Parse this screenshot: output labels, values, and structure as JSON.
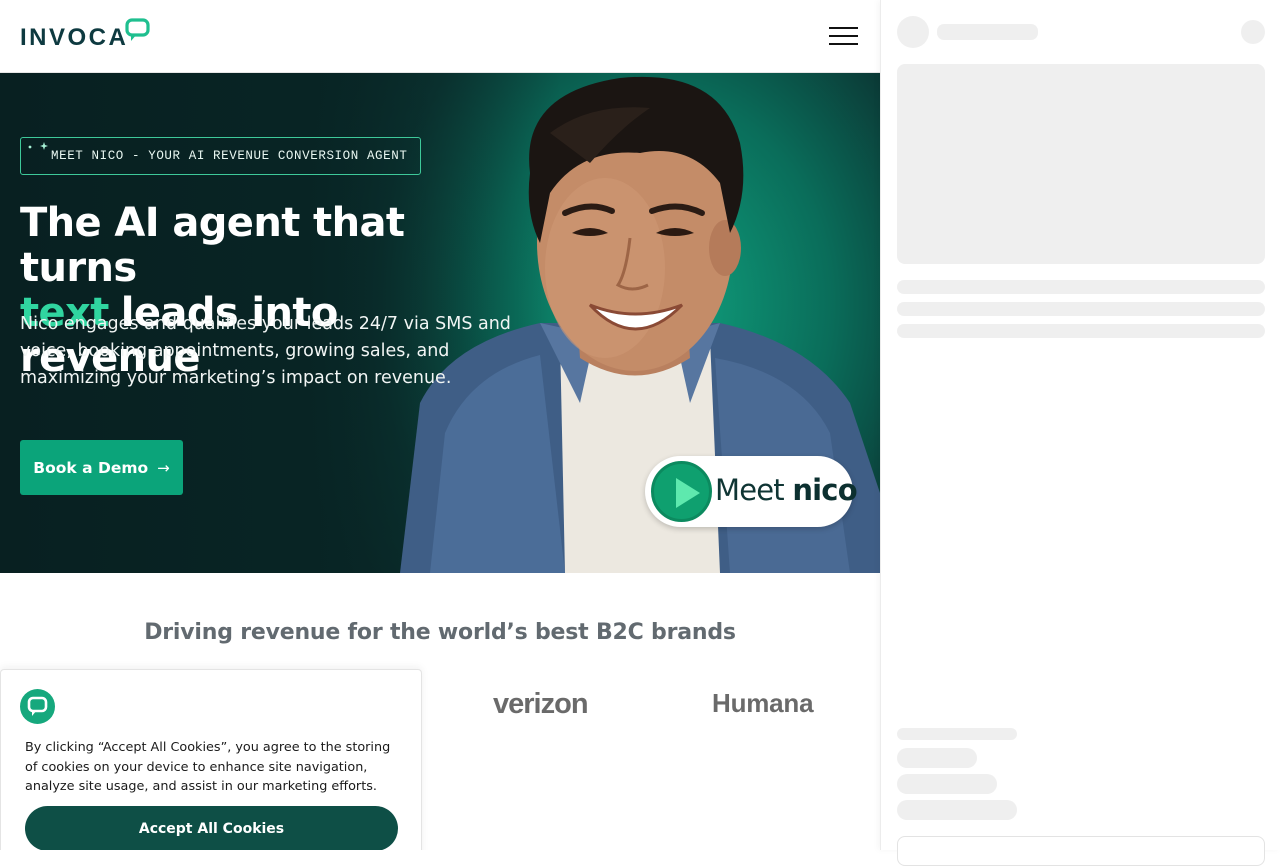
{
  "header": {
    "logo_text": "INVOCA",
    "menu_icon": "hamburger-menu-icon"
  },
  "hero": {
    "badge": "MEET NICO - YOUR AI REVENUE CONVERSION AGENT",
    "headline_line1": "The AI agent that turns",
    "headline_rotating_word": "text",
    "headline_line2": "leads into revenue",
    "subcopy": "Nico engages and qualifies your leads 24/7 via SMS and voice, booking appointments, growing sales, and maximizing your marketing’s impact on revenue.",
    "cta_label": "Book a Demo",
    "cta_icon": "arrow-right-icon",
    "video_pill": {
      "meet": "Meet",
      "name": "nico",
      "icon": "play-icon"
    },
    "colors": {
      "accent": "#0ba47a",
      "rotating_word": "#30d5a0",
      "bg_dark": "#0b2a2a"
    }
  },
  "brands": {
    "title": "Driving revenue for the world’s best B2C brands",
    "logos": [
      "verizon",
      "Humana"
    ]
  },
  "cookie_banner": {
    "text": "By clicking “Accept All Cookies”, you agree to the storing of cookies on your device to enhance site navigation, analyze site usage, and assist in our marketing efforts.",
    "accept_label": "Accept All Cookies",
    "logo_icon": "invoca-chat-icon",
    "button_color": "#0e4f46"
  },
  "side_panel": {
    "state": "loading-skeleton"
  }
}
